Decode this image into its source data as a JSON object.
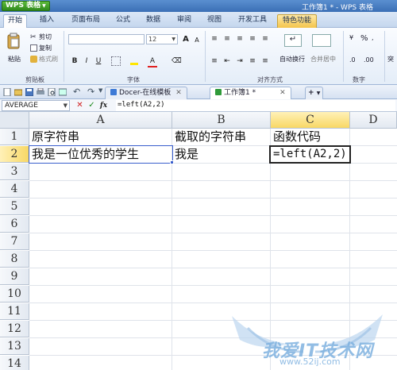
{
  "app": {
    "app_button": "WPS 表格",
    "window_title": "工作簿1 * - WPS 表格"
  },
  "ribbon_tabs": [
    "开始",
    "插入",
    "页面布局",
    "公式",
    "数据",
    "审阅",
    "视图",
    "开发工具",
    "特色功能"
  ],
  "ribbon": {
    "clipboard": {
      "paste": "粘贴",
      "cut": "剪切",
      "copy": "复制",
      "format_painter": "格式刷",
      "group": "剪贴板"
    },
    "font": {
      "size": "12",
      "group": "字体"
    },
    "alignment": {
      "merge_center": "合并居中",
      "wrap_text": "自动换行",
      "group": "对齐方式"
    },
    "number": {
      "percent": "%",
      "group": "数字"
    },
    "extra": "突"
  },
  "doc_tabs": [
    {
      "label": "Docer-在线模板"
    },
    {
      "label": "工作簿1 *"
    }
  ],
  "formula_bar": {
    "name_box": "AVERAGE",
    "cancel": "✕",
    "confirm": "✓",
    "fx": "fx",
    "formula": "=left(A2,2)"
  },
  "sheet": {
    "columns": [
      "A",
      "B",
      "C",
      "D"
    ],
    "rows": [
      "1",
      "2",
      "3",
      "4",
      "5",
      "6",
      "7",
      "8",
      "9",
      "10",
      "11",
      "12",
      "13",
      "14"
    ],
    "cells": {
      "A1": "原字符串",
      "B1": "截取的字符串",
      "C1": "函数代码",
      "A2": "我是一位优秀的学生",
      "B2": "我是",
      "C2": "=left(A2,2)"
    }
  },
  "watermark": {
    "text": "我爱IT技术网",
    "url": "www.52ij.com"
  },
  "colors": {
    "title_bar": "#3b6fb5",
    "app_button": "#2f8a1c",
    "selected_header": "#f8d865",
    "special_tab": "#f3c44b"
  }
}
